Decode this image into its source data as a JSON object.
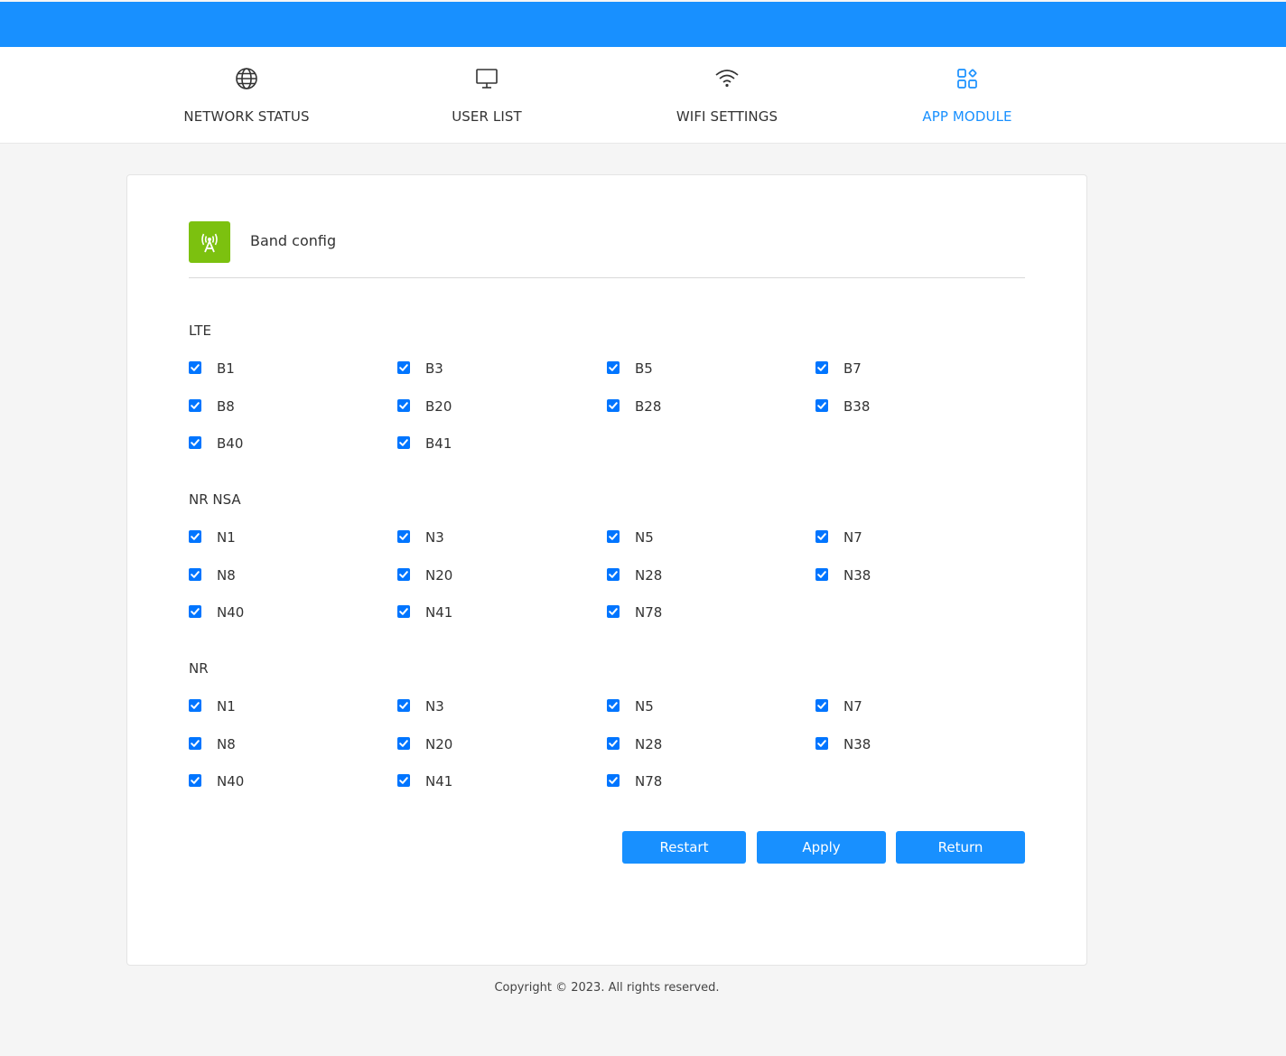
{
  "nav": {
    "items": [
      {
        "label": "NETWORK STATUS",
        "icon": "globe-icon",
        "active": false
      },
      {
        "label": "USER LIST",
        "icon": "monitor-icon",
        "active": false
      },
      {
        "label": "WIFI SETTINGS",
        "icon": "wifi-icon",
        "active": false
      },
      {
        "label": "APP MODULE",
        "icon": "apps-icon",
        "active": true
      }
    ]
  },
  "card": {
    "title": "Band config",
    "icon": "antenna-tower-icon",
    "sections": [
      {
        "title": "LTE",
        "bands": [
          {
            "label": "B1",
            "checked": true
          },
          {
            "label": "B3",
            "checked": true
          },
          {
            "label": "B5",
            "checked": true
          },
          {
            "label": "B7",
            "checked": true
          },
          {
            "label": "B8",
            "checked": true
          },
          {
            "label": "B20",
            "checked": true
          },
          {
            "label": "B28",
            "checked": true
          },
          {
            "label": "B38",
            "checked": true
          },
          {
            "label": "B40",
            "checked": true
          },
          {
            "label": "B41",
            "checked": true
          }
        ]
      },
      {
        "title": "NR NSA",
        "bands": [
          {
            "label": "N1",
            "checked": true
          },
          {
            "label": "N3",
            "checked": true
          },
          {
            "label": "N5",
            "checked": true
          },
          {
            "label": "N7",
            "checked": true
          },
          {
            "label": "N8",
            "checked": true
          },
          {
            "label": "N20",
            "checked": true
          },
          {
            "label": "N28",
            "checked": true
          },
          {
            "label": "N38",
            "checked": true
          },
          {
            "label": "N40",
            "checked": true
          },
          {
            "label": "N41",
            "checked": true
          },
          {
            "label": "N78",
            "checked": true
          }
        ]
      },
      {
        "title": "NR",
        "bands": [
          {
            "label": "N1",
            "checked": true
          },
          {
            "label": "N3",
            "checked": true
          },
          {
            "label": "N5",
            "checked": true
          },
          {
            "label": "N7",
            "checked": true
          },
          {
            "label": "N8",
            "checked": true
          },
          {
            "label": "N20",
            "checked": true
          },
          {
            "label": "N28",
            "checked": true
          },
          {
            "label": "N38",
            "checked": true
          },
          {
            "label": "N40",
            "checked": true
          },
          {
            "label": "N41",
            "checked": true
          },
          {
            "label": "N78",
            "checked": true
          }
        ]
      }
    ],
    "buttons": {
      "restart": "Restart",
      "apply": "Apply",
      "return": "Return"
    }
  },
  "footer": {
    "copyright": "Copyright © 2023. All rights reserved."
  },
  "colors": {
    "primary": "#1890ff",
    "checkbox": "#0075ff",
    "header_icon_bg": "#7cc10f",
    "page_bg": "#f5f5f5"
  }
}
